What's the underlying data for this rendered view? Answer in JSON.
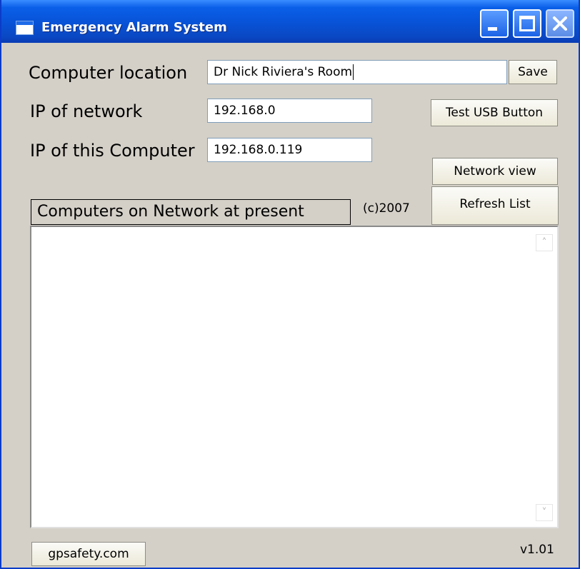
{
  "window": {
    "title": "Emergency Alarm System",
    "title_color": "#ffffff",
    "titlebar_color": "#0852d6",
    "face_color": "#d4d0c8"
  },
  "form": {
    "computer_location_label": "Computer location",
    "computer_location_value": "Dr Nick Riviera's Room",
    "ip_network_label": "IP of network",
    "ip_network_value": "192.168.0",
    "ip_computer_label": "IP of this Computer",
    "ip_computer_value": "192.168.0.119"
  },
  "buttons": {
    "save": "Save",
    "test_usb": "Test USB Button",
    "network_view": "Network view",
    "refresh_list": "Refresh List",
    "website": "gpsafety.com"
  },
  "list": {
    "caption": "Computers on Network at present",
    "items": []
  },
  "footer": {
    "copyright": "(c)2007",
    "version": "v1.01"
  },
  "icons": {
    "app": "window-app-icon",
    "minimize": "minimize-icon",
    "maximize": "maximize-icon",
    "close": "close-icon",
    "scroll_up": "chevron-up-icon",
    "scroll_down": "chevron-down-icon"
  }
}
